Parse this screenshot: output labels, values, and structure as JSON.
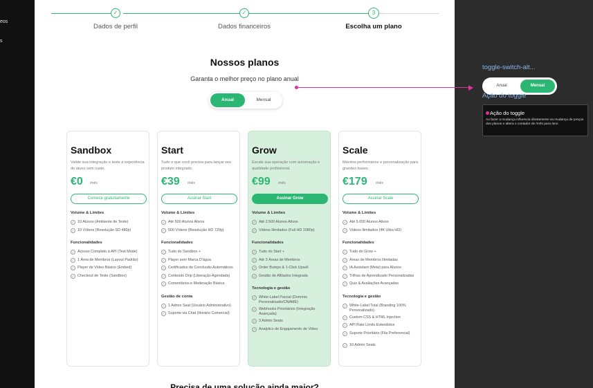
{
  "leftbar": {
    "items": [
      "eos",
      "s"
    ]
  },
  "stepper": {
    "steps": [
      {
        "label": "Dados de perfil",
        "state": "done"
      },
      {
        "label": "Dados financeiros",
        "state": "done"
      },
      {
        "label": "Escolha um plano",
        "state": "active",
        "number": "3"
      }
    ]
  },
  "heading": {
    "title": "Nossos planos",
    "subtitle": "Garanta o melhor preço no plano anual"
  },
  "billing_toggle": {
    "annual": "Anual",
    "monthly": "Mensal",
    "selected": "Anual"
  },
  "plans": [
    {
      "name": "Sandbox",
      "description": "Valide sua integração e teste a experiência do aluno sem custo.",
      "price": "€0",
      "period": "/mês",
      "cta": "Comece gratuitamente",
      "sections": [
        {
          "title": "Volume & Limites",
          "items": [
            "10 Alunos (Ambiente de Teste)",
            "10 Vídeos (Resolução SD 480p)"
          ]
        },
        {
          "title": "Funcionalidades",
          "items": [
            "Acesso Completo à API (Test Mode)",
            "1 Área de Membros (Layout Padrão)",
            "Player de Vídeo Básico (Embed)",
            "Checkout de Teste (Sandbox)"
          ]
        }
      ]
    },
    {
      "name": "Start",
      "description": "Tudo o que você precisa para lançar seu produto integrado.",
      "price": "€39",
      "period": "/mês",
      "cta": "Assinar Start",
      "sections": [
        {
          "title": "Volume & Limites",
          "items": [
            "Até 500 Alunos Ativos",
            "500 Vídeos (Resolução HD 720p)"
          ]
        },
        {
          "title": "Funcionalidades",
          "items": [
            "Tudo do Sandbox +",
            "Player sem Marca D'água",
            "Certificados de Conclusão Automáticos",
            "Conteúdo Drip (Liberação Agendada)",
            "Comentários e Moderação Básica"
          ]
        },
        {
          "title": "Gestão de conta",
          "items": [
            "1 Admin Seat (Usuário Administrativo)",
            "Suporte via Chat (Horário Comercial)"
          ]
        }
      ]
    },
    {
      "name": "Grow",
      "description": "Escale sua operação com automação e qualidade profissional.",
      "price": "€99",
      "period": "/mês",
      "cta": "Assinar Grow",
      "featured": true,
      "sections": [
        {
          "title": "Volume & Limites",
          "items": [
            "Até 2.500 Alunos Ativos",
            "Vídeos Ilimitados (Full HD 1080p)"
          ]
        },
        {
          "title": "Funcionalidades",
          "items": [
            "Tudo do Start +",
            "Até 3 Áreas de Membros",
            "Order Bumps & 1-Click Upsell",
            "Gestão de Afiliados Integrada"
          ]
        },
        {
          "title": "Tecnologia e gestão",
          "items": [
            "White-Label Parcial (Domínio Personalizado/CNAME)",
            "Webhooks Prioritários (Integração Avançada)",
            "3 Admin Seats",
            "Analytics de Engajamento de Vídeo"
          ]
        }
      ]
    },
    {
      "name": "Scale",
      "description": "Máxima performance e personalização para grandes bases.",
      "price": "€179",
      "period": "/mês",
      "cta": "Assinar Scale",
      "sections": [
        {
          "title": "Volume & Limites",
          "items": [
            "Até 5.000 Alunos Ativos",
            "Vídeos Ilimitados (4K Ultra HD)"
          ]
        },
        {
          "title": "Funcionalidades",
          "items": [
            "Tudo do Grow +",
            "Áreas de Membros Ilimitadas",
            "IA Assistant (Meta) para Alunos",
            "Trilhas de Aprendizado Personalizadas",
            "Quiz & Avaliações Avançadas"
          ]
        },
        {
          "title": "Tecnologia e gestão",
          "items": [
            "White-Label Total (Branding 100% Personalizado)",
            "Custom CSS & HTML Injection",
            "API Rate Limits Estendidos",
            "Suporte Prioritário (Fila Preferencial)",
            "10 Admin Seats"
          ]
        }
      ]
    }
  ],
  "footer_heading": "Precisa de uma solução ainda maior?",
  "annotation": {
    "component_label": "toggle-switch-alt...",
    "toggle_annual": "Anual",
    "toggle_monthly": "Mensal",
    "toggle_selected": "Mensal",
    "subtitle": "Ação do toggle",
    "tooltip_title": "Ação do toggle",
    "tooltip_body": "Ao fazer a mudança influencia diretamente na mudança de preços dos planos e altera o contador de /mês para /ano",
    "accent_color": "#e0309c"
  },
  "colors": {
    "brand_green": "#2bb673",
    "featured_bg": "#d7efdd",
    "label_blue": "#8ab4e6"
  }
}
